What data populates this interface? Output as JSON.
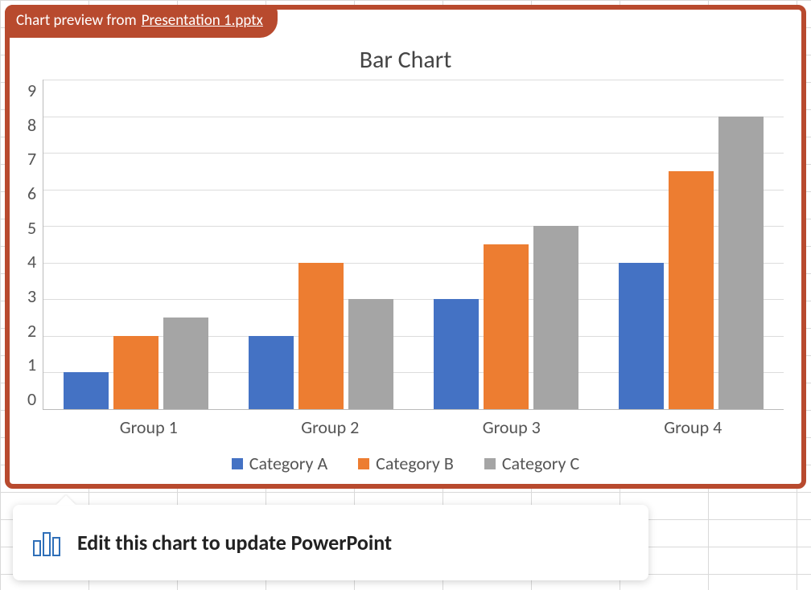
{
  "preview_tab": {
    "prefix": "Chart preview from ",
    "filename": "Presentation 1.pptx"
  },
  "callout": {
    "text": "Edit this chart to update PowerPoint"
  },
  "colors": {
    "series_a": "#4472C4",
    "series_b": "#ED7D31",
    "series_c": "#A5A5A5",
    "frame": "#b84a2e"
  },
  "chart_data": {
    "type": "bar",
    "title": "Bar Chart",
    "xlabel": "",
    "ylabel": "",
    "ylim": [
      0,
      9
    ],
    "yticks": [
      0,
      1,
      2,
      3,
      4,
      5,
      6,
      7,
      8,
      9
    ],
    "categories": [
      "Group 1",
      "Group 2",
      "Group 3",
      "Group 4"
    ],
    "series": [
      {
        "name": "Category A",
        "values": [
          1,
          2,
          3,
          4
        ]
      },
      {
        "name": "Category B",
        "values": [
          2,
          4,
          4.5,
          6.5
        ]
      },
      {
        "name": "Category C",
        "values": [
          2.5,
          3,
          5,
          8
        ]
      }
    ],
    "legend_position": "bottom",
    "grid": true
  }
}
